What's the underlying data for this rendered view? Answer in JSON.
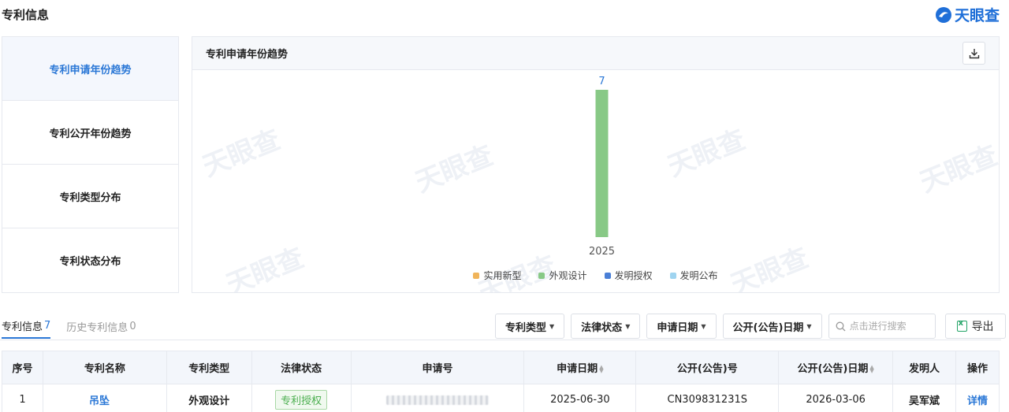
{
  "header": {
    "title": "专利信息",
    "brand": "天眼查"
  },
  "side_menu": {
    "items": [
      {
        "label": "专利申请年份趋势",
        "active": true
      },
      {
        "label": "专利公开年份趋势",
        "active": false
      },
      {
        "label": "专利类型分布",
        "active": false
      },
      {
        "label": "专利状态分布",
        "active": false
      }
    ]
  },
  "chart_panel": {
    "title": "专利申请年份趋势",
    "download_icon": "download-icon"
  },
  "chart_data": {
    "type": "bar",
    "categories": [
      "2025"
    ],
    "series": [
      {
        "name": "实用新型",
        "color": "#f0b45a",
        "values": [
          0
        ]
      },
      {
        "name": "外观设计",
        "color": "#88c986",
        "values": [
          7
        ]
      },
      {
        "name": "发明授权",
        "color": "#4a7fd6",
        "values": [
          0
        ]
      },
      {
        "name": "发明公布",
        "color": "#9fd4f0",
        "values": [
          0
        ]
      }
    ],
    "data_labels": [
      "7"
    ],
    "ylim": [
      0,
      7
    ],
    "grid": false,
    "legend_position": "bottom"
  },
  "watermark": {
    "text": "天眼查"
  },
  "tabs": [
    {
      "label": "专利信息",
      "count": "7",
      "active": true
    },
    {
      "label": "历史专利信息",
      "count": "0",
      "active": false
    }
  ],
  "filters": {
    "patent_type": "专利类型",
    "legal_status": "法律状态",
    "apply_date": "申请日期",
    "publish_date": "公开(公告)日期",
    "search_placeholder": "点击进行搜索",
    "export_label": "导出"
  },
  "table": {
    "headers": [
      "序号",
      "专利名称",
      "专利类型",
      "法律状态",
      "申请号",
      "申请日期",
      "公开(公告)号",
      "公开(公告)日期",
      "发明人",
      "操作"
    ],
    "rows": [
      {
        "index": "1",
        "name": "吊坠",
        "type": "外观设计",
        "status": "专利授权",
        "apply_date": "2025-06-30",
        "publish_no": "CN309831231S",
        "publish_date": "2026-03-06",
        "inventor": "吴军斌",
        "action": "详情"
      }
    ]
  },
  "colors": {
    "accent": "#2a77d6",
    "bar": "#88c986",
    "status_green": "#4caf50"
  }
}
